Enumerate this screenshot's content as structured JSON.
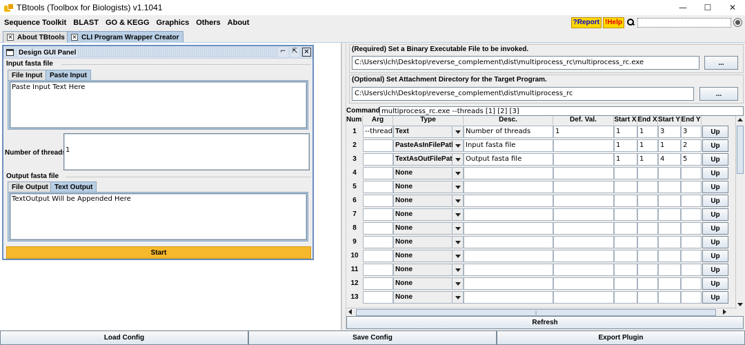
{
  "window": {
    "title": "TBtools (Toolbox for Biologists) v1.1041",
    "minimize": "—",
    "maximize": "☐",
    "close": "✕"
  },
  "menu": {
    "items": [
      "Sequence Toolkit",
      "BLAST",
      "GO & KEGG",
      "Graphics",
      "Others",
      "About"
    ],
    "report_label": "?Report",
    "help_label": "!Help",
    "search_value": ""
  },
  "tabs": [
    "About TBtools",
    "CLI Program Wrapper Creator"
  ],
  "design_panel": {
    "title": "Design GUI Panel",
    "controls": [
      "⌐",
      "⇱",
      "✕"
    ],
    "input_section": "Input fasta file",
    "input_tabs": [
      "File Input",
      "Paste Input"
    ],
    "input_text": "Paste Input Text Here",
    "threads_label": "Number of threads:",
    "threads_value": "1",
    "output_section": "Output fasta file",
    "output_tabs": [
      "File Output",
      "Text Output"
    ],
    "output_text": "TextOutput Will be Appended Here",
    "start_label": "Start"
  },
  "right": {
    "binary_label": "(Required) Set a Binary Executable File to be invoked.",
    "binary_path": "C:\\Users\\lch\\Desktop\\reverse_complement\\dist\\multiprocess_rc\\multiprocess_rc.exe",
    "attach_label": "(Optional) Set Attachment Directory for the Target Program.",
    "attach_path": "C:\\Users\\lch\\Desktop\\reverse_complement\\dist\\multiprocess_rc",
    "browse_label": "...",
    "command_label": "Command:",
    "command_value": "multiprocess_rc.exe  --threads [1]  [2]  [3]",
    "refresh_label": "Refresh"
  },
  "table": {
    "headers": [
      "Num.",
      "Arg",
      "Type",
      "Desc.",
      "Def. Val.",
      "Start X",
      "End X",
      "Start Y",
      "End Y"
    ],
    "up_label": "Up",
    "rows": [
      {
        "num": "1",
        "arg": "--threads",
        "type": "Text",
        "desc": "Number of threads",
        "def": "1",
        "sx": "1",
        "ex": "1",
        "sy": "3",
        "ey": "3"
      },
      {
        "num": "2",
        "arg": "",
        "type": "PasteAsInFilePath",
        "desc": "Input fasta file",
        "def": "",
        "sx": "1",
        "ex": "1",
        "sy": "1",
        "ey": "2"
      },
      {
        "num": "3",
        "arg": "",
        "type": "TextAsOutFilePath",
        "desc": "Output fasta file",
        "def": "",
        "sx": "1",
        "ex": "1",
        "sy": "4",
        "ey": "5"
      },
      {
        "num": "4",
        "arg": "",
        "type": "None",
        "desc": "",
        "def": "",
        "sx": "",
        "ex": "",
        "sy": "",
        "ey": ""
      },
      {
        "num": "5",
        "arg": "",
        "type": "None",
        "desc": "",
        "def": "",
        "sx": "",
        "ex": "",
        "sy": "",
        "ey": ""
      },
      {
        "num": "6",
        "arg": "",
        "type": "None",
        "desc": "",
        "def": "",
        "sx": "",
        "ex": "",
        "sy": "",
        "ey": ""
      },
      {
        "num": "7",
        "arg": "",
        "type": "None",
        "desc": "",
        "def": "",
        "sx": "",
        "ex": "",
        "sy": "",
        "ey": ""
      },
      {
        "num": "8",
        "arg": "",
        "type": "None",
        "desc": "",
        "def": "",
        "sx": "",
        "ex": "",
        "sy": "",
        "ey": ""
      },
      {
        "num": "9",
        "arg": "",
        "type": "None",
        "desc": "",
        "def": "",
        "sx": "",
        "ex": "",
        "sy": "",
        "ey": ""
      },
      {
        "num": "10",
        "arg": "",
        "type": "None",
        "desc": "",
        "def": "",
        "sx": "",
        "ex": "",
        "sy": "",
        "ey": ""
      },
      {
        "num": "11",
        "arg": "",
        "type": "None",
        "desc": "",
        "def": "",
        "sx": "",
        "ex": "",
        "sy": "",
        "ey": ""
      },
      {
        "num": "12",
        "arg": "",
        "type": "None",
        "desc": "",
        "def": "",
        "sx": "",
        "ex": "",
        "sy": "",
        "ey": ""
      },
      {
        "num": "13",
        "arg": "",
        "type": "None",
        "desc": "",
        "def": "",
        "sx": "",
        "ex": "",
        "sy": "",
        "ey": ""
      }
    ]
  },
  "bottom": [
    "Load Config",
    "Save Config",
    "Export Plugin"
  ]
}
